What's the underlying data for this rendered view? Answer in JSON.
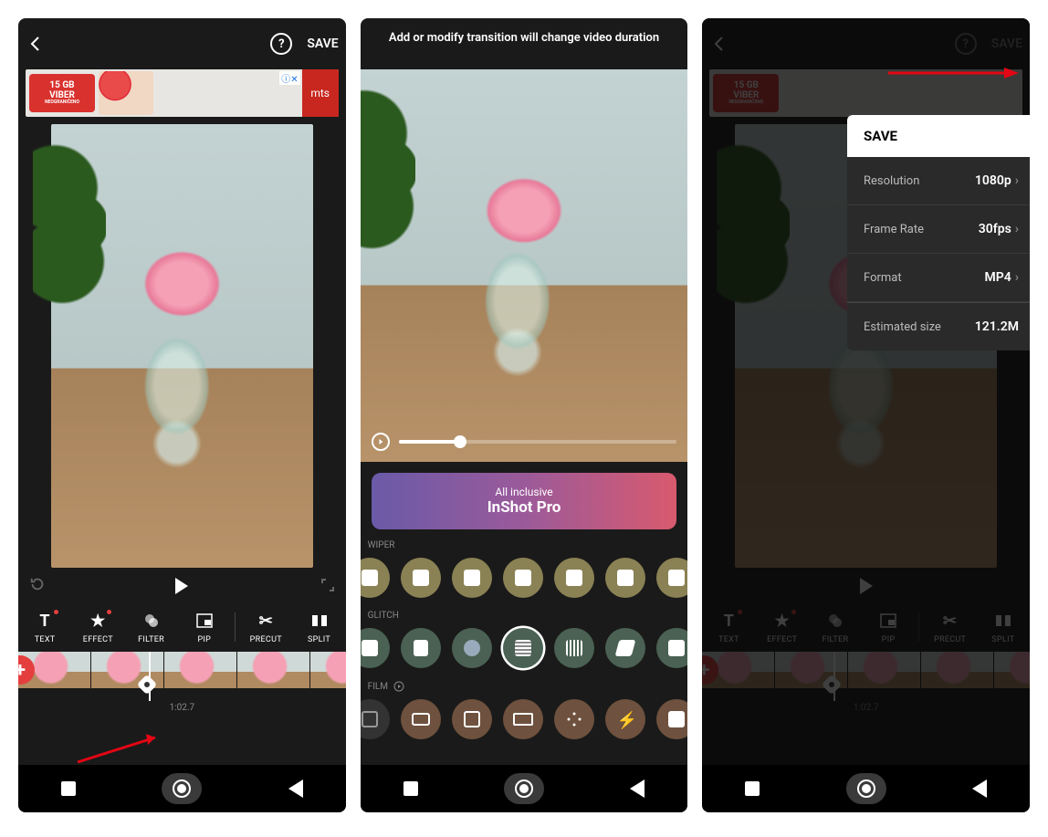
{
  "screen1": {
    "save": "SAVE",
    "ad": {
      "line1": "15 GB",
      "line2": "VIBER",
      "line3": "NEOGRANIČENO",
      "mts": "mts",
      "close": "ⓘ✕"
    },
    "tools": [
      {
        "label": "TEXT"
      },
      {
        "label": "EFFECT"
      },
      {
        "label": "FILTER"
      },
      {
        "label": "PIP"
      },
      {
        "label": "PRECUT"
      },
      {
        "label": "SPLIT"
      }
    ],
    "time": "1:02.7"
  },
  "screen2": {
    "hint": "Add or modify transition will change video duration",
    "pro": {
      "sub": "All inclusive",
      "title": "InShot Pro"
    },
    "sections": {
      "wipe": "WIPER",
      "glitch": "GLITCH",
      "film": "FILM"
    }
  },
  "screen3": {
    "save": "SAVE",
    "panel": {
      "header": "SAVE",
      "rows": [
        {
          "label": "Resolution",
          "value": "1080p",
          "arrow": true
        },
        {
          "label": "Frame Rate",
          "value": "30fps",
          "arrow": true
        },
        {
          "label": "Format",
          "value": "MP4",
          "arrow": true
        },
        {
          "label": "Estimated size",
          "value": "121.2M",
          "arrow": false
        }
      ]
    },
    "tools": [
      {
        "label": "TEXT"
      },
      {
        "label": "EFFECT"
      },
      {
        "label": "FILTER"
      },
      {
        "label": "PIP"
      },
      {
        "label": "PRECUT"
      },
      {
        "label": "SPLIT"
      }
    ],
    "time": "1:02.7"
  }
}
